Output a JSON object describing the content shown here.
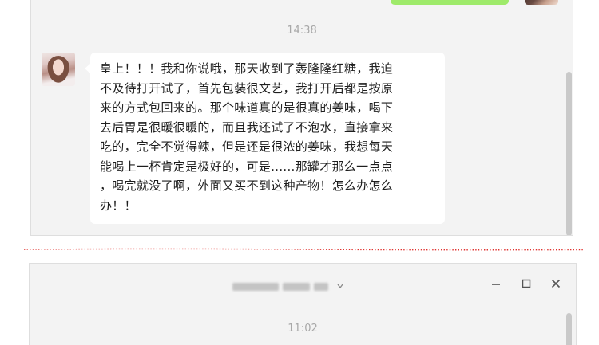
{
  "chat_top": {
    "timestamp": "14:38",
    "message": "皇上！！！我和你说哦，那天收到了轰隆隆红糖，我迫\n不及待打开试了，首先包装很文艺，我打开后都是按原\n来的方式包回来的。那个味道真的是很真的姜味，喝下\n去后胃是很暖很暖的，而且我还试了不泡水，直接拿来\n吃的，完全不觉得辣，但是还是很浓的姜味，我想每天\n能喝上一杯肯定是极好的，可是......那罐才那么一点点\n，喝完就没了啊，外面又买不到这种产物！怎么办怎么\n办！！"
  },
  "colors": {
    "sent_bubble": "#9eea6a",
    "separator": "#e0322f",
    "panel_bg": "#f3f3f3"
  },
  "chat_bottom": {
    "title_obscured": true,
    "window_controls": {
      "minimize_icon": "minimize-icon",
      "maximize_icon": "maximize-icon",
      "close_icon": "close-icon"
    },
    "timestamp": "11:02"
  }
}
